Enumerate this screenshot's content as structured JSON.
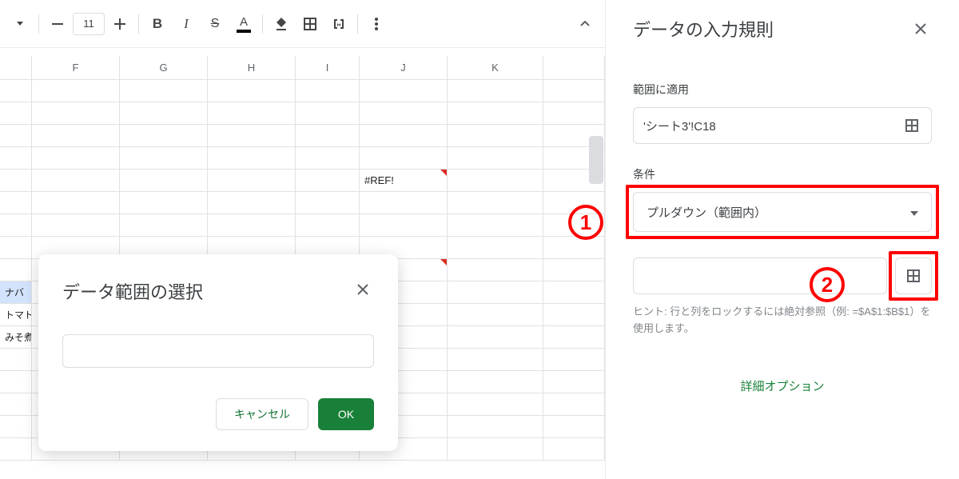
{
  "toolbar": {
    "font_size": "11"
  },
  "columns": [
    "F",
    "G",
    "H",
    "I",
    "J",
    "K"
  ],
  "cells": {
    "ref_error": "#REF!",
    "a1": "ナバ",
    "a2": "トマト",
    "a3": "みそ煮"
  },
  "dialog": {
    "title": "データ範囲の選択",
    "cancel": "キャンセル",
    "ok": "OK"
  },
  "panel": {
    "title": "データの入力規則",
    "range_label": "範囲に適用",
    "range_value": "'シート3'!C18",
    "cond_label": "条件",
    "cond_value": "プルダウン（範囲内）",
    "hint": "ヒント: 行と列をロックするには絶対参照（例: =$A$1:$B$1）を使用します。",
    "advanced": "詳細オプション"
  },
  "annotations": {
    "one": "1",
    "two": "2"
  }
}
